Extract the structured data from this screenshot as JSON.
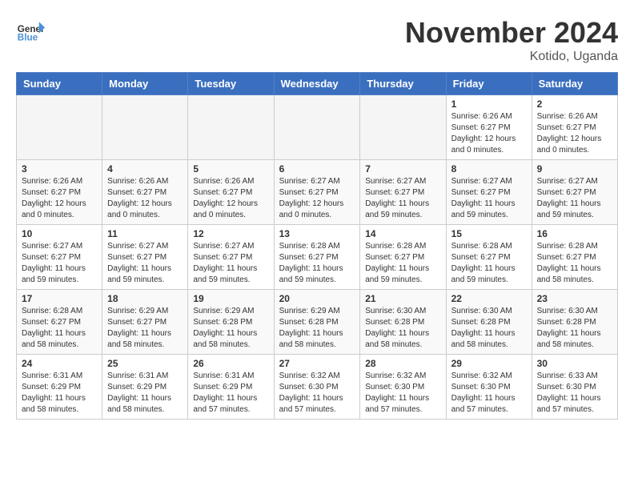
{
  "logo": {
    "text_general": "General",
    "text_blue": "Blue"
  },
  "title": "November 2024",
  "location": "Kotido, Uganda",
  "days_of_week": [
    "Sunday",
    "Monday",
    "Tuesday",
    "Wednesday",
    "Thursday",
    "Friday",
    "Saturday"
  ],
  "weeks": [
    [
      {
        "day": "",
        "info": ""
      },
      {
        "day": "",
        "info": ""
      },
      {
        "day": "",
        "info": ""
      },
      {
        "day": "",
        "info": ""
      },
      {
        "day": "",
        "info": ""
      },
      {
        "day": "1",
        "info": "Sunrise: 6:26 AM\nSunset: 6:27 PM\nDaylight: 12 hours and 0 minutes."
      },
      {
        "day": "2",
        "info": "Sunrise: 6:26 AM\nSunset: 6:27 PM\nDaylight: 12 hours and 0 minutes."
      }
    ],
    [
      {
        "day": "3",
        "info": "Sunrise: 6:26 AM\nSunset: 6:27 PM\nDaylight: 12 hours and 0 minutes."
      },
      {
        "day": "4",
        "info": "Sunrise: 6:26 AM\nSunset: 6:27 PM\nDaylight: 12 hours and 0 minutes."
      },
      {
        "day": "5",
        "info": "Sunrise: 6:26 AM\nSunset: 6:27 PM\nDaylight: 12 hours and 0 minutes."
      },
      {
        "day": "6",
        "info": "Sunrise: 6:27 AM\nSunset: 6:27 PM\nDaylight: 12 hours and 0 minutes."
      },
      {
        "day": "7",
        "info": "Sunrise: 6:27 AM\nSunset: 6:27 PM\nDaylight: 11 hours and 59 minutes."
      },
      {
        "day": "8",
        "info": "Sunrise: 6:27 AM\nSunset: 6:27 PM\nDaylight: 11 hours and 59 minutes."
      },
      {
        "day": "9",
        "info": "Sunrise: 6:27 AM\nSunset: 6:27 PM\nDaylight: 11 hours and 59 minutes."
      }
    ],
    [
      {
        "day": "10",
        "info": "Sunrise: 6:27 AM\nSunset: 6:27 PM\nDaylight: 11 hours and 59 minutes."
      },
      {
        "day": "11",
        "info": "Sunrise: 6:27 AM\nSunset: 6:27 PM\nDaylight: 11 hours and 59 minutes."
      },
      {
        "day": "12",
        "info": "Sunrise: 6:27 AM\nSunset: 6:27 PM\nDaylight: 11 hours and 59 minutes."
      },
      {
        "day": "13",
        "info": "Sunrise: 6:28 AM\nSunset: 6:27 PM\nDaylight: 11 hours and 59 minutes."
      },
      {
        "day": "14",
        "info": "Sunrise: 6:28 AM\nSunset: 6:27 PM\nDaylight: 11 hours and 59 minutes."
      },
      {
        "day": "15",
        "info": "Sunrise: 6:28 AM\nSunset: 6:27 PM\nDaylight: 11 hours and 59 minutes."
      },
      {
        "day": "16",
        "info": "Sunrise: 6:28 AM\nSunset: 6:27 PM\nDaylight: 11 hours and 58 minutes."
      }
    ],
    [
      {
        "day": "17",
        "info": "Sunrise: 6:28 AM\nSunset: 6:27 PM\nDaylight: 11 hours and 58 minutes."
      },
      {
        "day": "18",
        "info": "Sunrise: 6:29 AM\nSunset: 6:27 PM\nDaylight: 11 hours and 58 minutes."
      },
      {
        "day": "19",
        "info": "Sunrise: 6:29 AM\nSunset: 6:28 PM\nDaylight: 11 hours and 58 minutes."
      },
      {
        "day": "20",
        "info": "Sunrise: 6:29 AM\nSunset: 6:28 PM\nDaylight: 11 hours and 58 minutes."
      },
      {
        "day": "21",
        "info": "Sunrise: 6:30 AM\nSunset: 6:28 PM\nDaylight: 11 hours and 58 minutes."
      },
      {
        "day": "22",
        "info": "Sunrise: 6:30 AM\nSunset: 6:28 PM\nDaylight: 11 hours and 58 minutes."
      },
      {
        "day": "23",
        "info": "Sunrise: 6:30 AM\nSunset: 6:28 PM\nDaylight: 11 hours and 58 minutes."
      }
    ],
    [
      {
        "day": "24",
        "info": "Sunrise: 6:31 AM\nSunset: 6:29 PM\nDaylight: 11 hours and 58 minutes."
      },
      {
        "day": "25",
        "info": "Sunrise: 6:31 AM\nSunset: 6:29 PM\nDaylight: 11 hours and 58 minutes."
      },
      {
        "day": "26",
        "info": "Sunrise: 6:31 AM\nSunset: 6:29 PM\nDaylight: 11 hours and 57 minutes."
      },
      {
        "day": "27",
        "info": "Sunrise: 6:32 AM\nSunset: 6:30 PM\nDaylight: 11 hours and 57 minutes."
      },
      {
        "day": "28",
        "info": "Sunrise: 6:32 AM\nSunset: 6:30 PM\nDaylight: 11 hours and 57 minutes."
      },
      {
        "day": "29",
        "info": "Sunrise: 6:32 AM\nSunset: 6:30 PM\nDaylight: 11 hours and 57 minutes."
      },
      {
        "day": "30",
        "info": "Sunrise: 6:33 AM\nSunset: 6:30 PM\nDaylight: 11 hours and 57 minutes."
      }
    ]
  ]
}
